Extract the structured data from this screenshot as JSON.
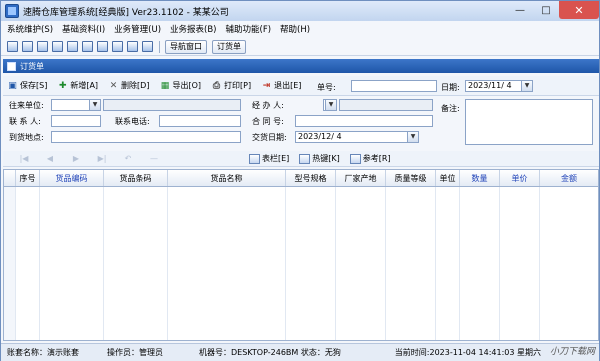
{
  "window": {
    "title": "速腾仓库管理系统[经典版] Ver23.1102 - 某某公司"
  },
  "menu": [
    "系统维护(S)",
    "基础资料(I)",
    "业务管理(U)",
    "业务报表(B)",
    "辅助功能(F)",
    "帮助(H)"
  ],
  "toolbar": {
    "nav_window": "导航窗口",
    "order_tab": "订货单"
  },
  "tab": {
    "label": "订货单"
  },
  "actions": {
    "save": "保存[S]",
    "add": "新增[A]",
    "delete": "删除[D]",
    "export": "导出[O]",
    "print": "打印[P]",
    "exit": "退出[E]",
    "order_no_label": "单号:",
    "order_no_value": "",
    "date_label": "日期:",
    "date_value": "2023/11/ 4"
  },
  "form": {
    "partner_label": "往来单位:",
    "contact_label": "联 系 人:",
    "phone_label": "联系电话:",
    "address_label": "到货地点:",
    "handler_label": "经 办 人:",
    "contract_label": "合 同 号:",
    "delivery_label": "交货日期:",
    "delivery_value": "2023/12/ 4",
    "remark_label": "备注:"
  },
  "toolbar2": {
    "columns": "表栏[E]",
    "hotkey": "热键[K]",
    "reference": "参考[R]"
  },
  "grid": {
    "headers": [
      "序号",
      "货品编码",
      "货品条码",
      "货品名称",
      "型号规格",
      "厂家产地",
      "质量等级",
      "单位",
      "数量",
      "单价",
      "金额"
    ]
  },
  "status": {
    "account": "账套名称：演示账套",
    "operator": "操作员：管理员",
    "machine": "机器号：DESKTOP-246BM 状态：无狗",
    "time": "当前时间:2023-11-04 14:41:03 星期六"
  },
  "watermark": "小刀下载网",
  "colors": {
    "accent": "#1f56a8",
    "blue_header": "#2043b8"
  }
}
